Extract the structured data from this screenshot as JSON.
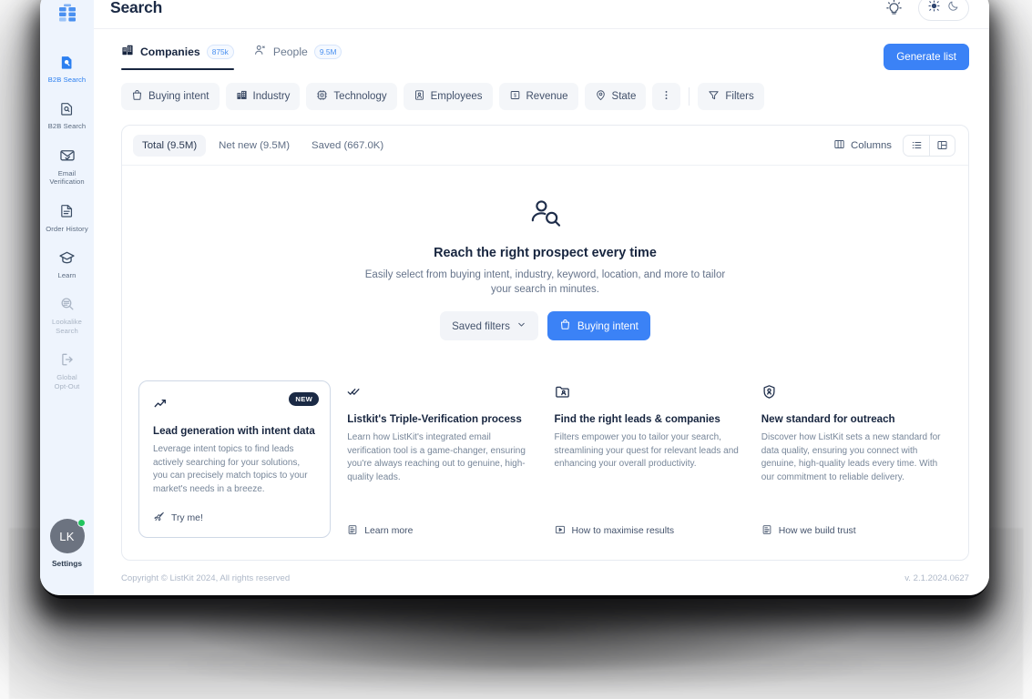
{
  "sidebar": {
    "logo_icon": "listkit-logo-icon",
    "items": [
      {
        "label": "B2B Search",
        "icon": "document-search-icon",
        "state": "active"
      },
      {
        "label": "B2B Search",
        "icon": "document-search-icon",
        "state": "normal"
      },
      {
        "label": "Email\nVerification",
        "label_line1": "Email",
        "label_line2": "Verification",
        "icon": "mail-check-icon",
        "state": "normal"
      },
      {
        "label": "Order History",
        "icon": "document-icon",
        "state": "normal"
      },
      {
        "label": "Learn",
        "icon": "graduation-cap-icon",
        "state": "normal"
      },
      {
        "label": "Lookalike\nSearch",
        "label_line1": "Lookalike",
        "label_line2": "Search",
        "icon": "lookalike-search-icon",
        "state": "dim"
      },
      {
        "label": "Global\nOpt-Out",
        "label_line1": "Global",
        "label_line2": "Opt-Out",
        "icon": "logout-icon",
        "state": "dim"
      }
    ],
    "profile": {
      "initials": "LK",
      "label": "Settings",
      "status": "online"
    }
  },
  "topbar": {
    "title": "Search",
    "lightbulb_icon": "lightbulb-icon",
    "theme": {
      "sun_icon": "sun-icon",
      "moon_icon": "moon-icon"
    }
  },
  "tabs": [
    {
      "label": "Companies",
      "count": "875k",
      "icon": "building-icon",
      "active": true
    },
    {
      "label": "People",
      "count": "9.5M",
      "icon": "people-icon",
      "active": false
    }
  ],
  "generate_button": {
    "label": "Generate list"
  },
  "filter_chips": [
    {
      "label": "Buying intent",
      "icon": "bag-icon"
    },
    {
      "label": "Industry",
      "icon": "building-grid-icon"
    },
    {
      "label": "Technology",
      "icon": "chip-icon"
    },
    {
      "label": "Employees",
      "icon": "badge-person-icon"
    },
    {
      "label": "Revenue",
      "icon": "dollar-square-icon"
    },
    {
      "label": "State",
      "icon": "map-pin-icon"
    },
    {
      "label": "",
      "icon": "more-vertical-icon"
    },
    {
      "label": "Filters",
      "icon": "funnel-icon"
    }
  ],
  "panel": {
    "segments": [
      {
        "label": "Total (9.5M)",
        "active": true
      },
      {
        "label": "Net new (9.5M)",
        "active": false
      },
      {
        "label": "Saved (667.0K)",
        "active": false
      }
    ],
    "columns_button": {
      "label": "Columns",
      "icon": "columns-icon"
    },
    "view_toggle": [
      {
        "icon": "list-view-icon",
        "active": true
      },
      {
        "icon": "split-view-icon",
        "active": false
      }
    ]
  },
  "empty_state": {
    "icon": "person-search-icon",
    "title": "Reach the right prospect every time",
    "subtitle": "Easily select from buying intent, industry, keyword, location, and more to tailor your search in minutes.",
    "saved_filters_button": {
      "label": "Saved filters",
      "icon": "chevron-down-icon"
    },
    "buying_intent_button": {
      "label": "Buying intent",
      "icon": "bag-icon"
    }
  },
  "cards": [
    {
      "icon": "trend-up-icon",
      "badge": "NEW",
      "title": "Lead generation with intent data",
      "text": "Leverage intent topics to find leads actively searching for your solutions, you can precisely match topics to your market's needs in a breeze.",
      "link": {
        "label": "Try me!",
        "icon": "rocket-icon"
      },
      "boxed": true
    },
    {
      "icon": "double-check-icon",
      "badge": "",
      "title": "Listkit's Triple-Verification process",
      "text": "Learn how ListKit's integrated email verification tool is a game-changer, ensuring you're always reaching out to genuine, high-quality leads.",
      "link": {
        "label": "Learn more",
        "icon": "article-icon"
      },
      "boxed": false
    },
    {
      "icon": "folder-user-icon",
      "badge": "",
      "title": "Find the right leads & companies",
      "text": "Filters empower you to tailor your search, streamlining your quest for relevant leads and enhancing your overall productivity.",
      "link": {
        "label": "How to maximise results",
        "icon": "play-icon"
      },
      "boxed": false
    },
    {
      "icon": "shield-check-icon",
      "badge": "",
      "title": "New standard for outreach",
      "text": "Discover how ListKit sets a new standard for data quality, ensuring you connect with genuine, high-quality leads every time. With our commitment to reliable delivery.",
      "link": {
        "label": "How we build trust",
        "icon": "article-icon"
      },
      "boxed": false
    }
  ],
  "footer": {
    "copyright": "Copyright © ListKit 2024, All rights reserved",
    "version": "v. 2.1.2024.0627"
  },
  "colors": {
    "accent": "#3b82f6",
    "sidebar_bg": "#eef4fd",
    "dark_text": "#17253f",
    "muted_text": "#778699",
    "status_online": "#22c55e"
  }
}
